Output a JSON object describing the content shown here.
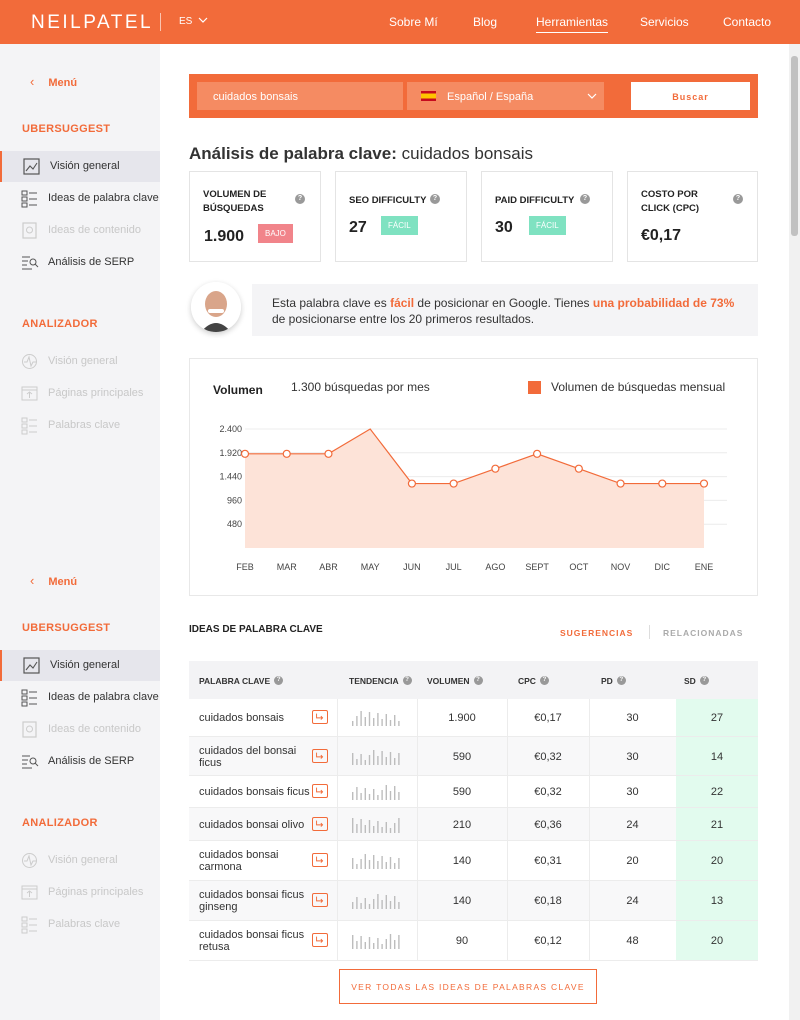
{
  "header": {
    "logo": "NEILPATEL",
    "lang": "ES",
    "nav": [
      "Sobre Mí",
      "Blog",
      "Herramientas",
      "Servicios",
      "Contacto"
    ]
  },
  "sidebar": {
    "menu_label": "Menú",
    "ubersuggest_heading": "UBERSUGGEST",
    "ubersuggest_items": [
      "Visión general",
      "Ideas de palabra clave",
      "Ideas de contenido",
      "Análisis de SERP"
    ],
    "analizador_heading": "ANALIZADOR",
    "analizador_items": [
      "Visión general",
      "Páginas principales",
      "Palabras clave"
    ]
  },
  "search": {
    "query": "cuidados bonsais",
    "country": "Español / España",
    "button": "Buscar"
  },
  "page_title": {
    "prefix": "Análisis de palabra clave:",
    "keyword": "cuidados bonsais"
  },
  "metrics": [
    {
      "label_1": "VOLUMEN DE",
      "label_2": "BÚSQUEDAS",
      "value": "1.900",
      "badge": "BAJO"
    },
    {
      "label_1": "SEO DIFFICULTY",
      "label_2": "",
      "value": "27",
      "badge": "FÁCIL"
    },
    {
      "label_1": "PAID DIFFICULTY",
      "label_2": "",
      "value": "30",
      "badge": "FÁCIL"
    },
    {
      "label_1": "COSTO POR",
      "label_2": "CLICK (CPC)",
      "value": "€0,17",
      "badge": ""
    }
  ],
  "tip": {
    "t1": "Esta palabra clave es ",
    "h1": "fácil",
    "t2": " de posicionar en Google. Tienes ",
    "h2": "una probabilidad de 73%",
    "t3": " de posicionarse entre los 20 primeros resultados."
  },
  "chart": {
    "title": "Volumen",
    "subtitle": "1.300 búsquedas por mes",
    "legend": "Volumen de búsquedas mensual"
  },
  "chart_data": {
    "type": "area",
    "categories": [
      "FEB",
      "MAR",
      "ABR",
      "MAY",
      "JUN",
      "JUL",
      "AGO",
      "SEPT",
      "OCT",
      "NOV",
      "DIC",
      "ENE"
    ],
    "series": [
      {
        "name": "Volumen de búsquedas mensual",
        "values": [
          1900,
          1900,
          1900,
          2400,
          1300,
          1300,
          1600,
          1900,
          1600,
          1300,
          1300,
          1300
        ]
      }
    ],
    "yticks": [
      "2.400",
      "1.920",
      "1.440",
      "960",
      "480"
    ],
    "ytick_values": [
      2400,
      1920,
      1440,
      960,
      480
    ],
    "ylim": [
      0,
      2400
    ],
    "markers_on": [
      0,
      1,
      2,
      4,
      5,
      6,
      7,
      8,
      9,
      10,
      11
    ],
    "color": "#f26b3a",
    "fill": "#fde3d8"
  },
  "ideas": {
    "title": "IDEAS DE PALABRA CLAVE",
    "tab_suggestions": "SUGERENCIAS",
    "tab_related": "RELACIONADAS",
    "columns": [
      "PALABRA CLAVE",
      "TENDENCIA",
      "VOLUMEN",
      "CPC",
      "PD",
      "SD"
    ],
    "rows": [
      {
        "kw": "cuidados bonsais",
        "vol": "1.900",
        "cpc": "€0,17",
        "pd": "30",
        "sd": "27"
      },
      {
        "kw": "cuidados del bonsai ficus",
        "vol": "590",
        "cpc": "€0,32",
        "pd": "30",
        "sd": "14"
      },
      {
        "kw": "cuidados bonsais ficus",
        "vol": "590",
        "cpc": "€0,32",
        "pd": "30",
        "sd": "22"
      },
      {
        "kw": "cuidados bonsai olivo",
        "vol": "210",
        "cpc": "€0,36",
        "pd": "24",
        "sd": "21"
      },
      {
        "kw": "cuidados bonsai carmona",
        "vol": "140",
        "cpc": "€0,31",
        "pd": "20",
        "sd": "20"
      },
      {
        "kw": "cuidados bonsai ficus ginseng",
        "vol": "140",
        "cpc": "€0,18",
        "pd": "24",
        "sd": "13"
      },
      {
        "kw": "cuidados bonsai ficus retusa",
        "vol": "90",
        "cpc": "€0,12",
        "pd": "48",
        "sd": "20"
      }
    ],
    "more_button": "VER TODAS LAS IDEAS DE PALABRAS CLAVE"
  }
}
